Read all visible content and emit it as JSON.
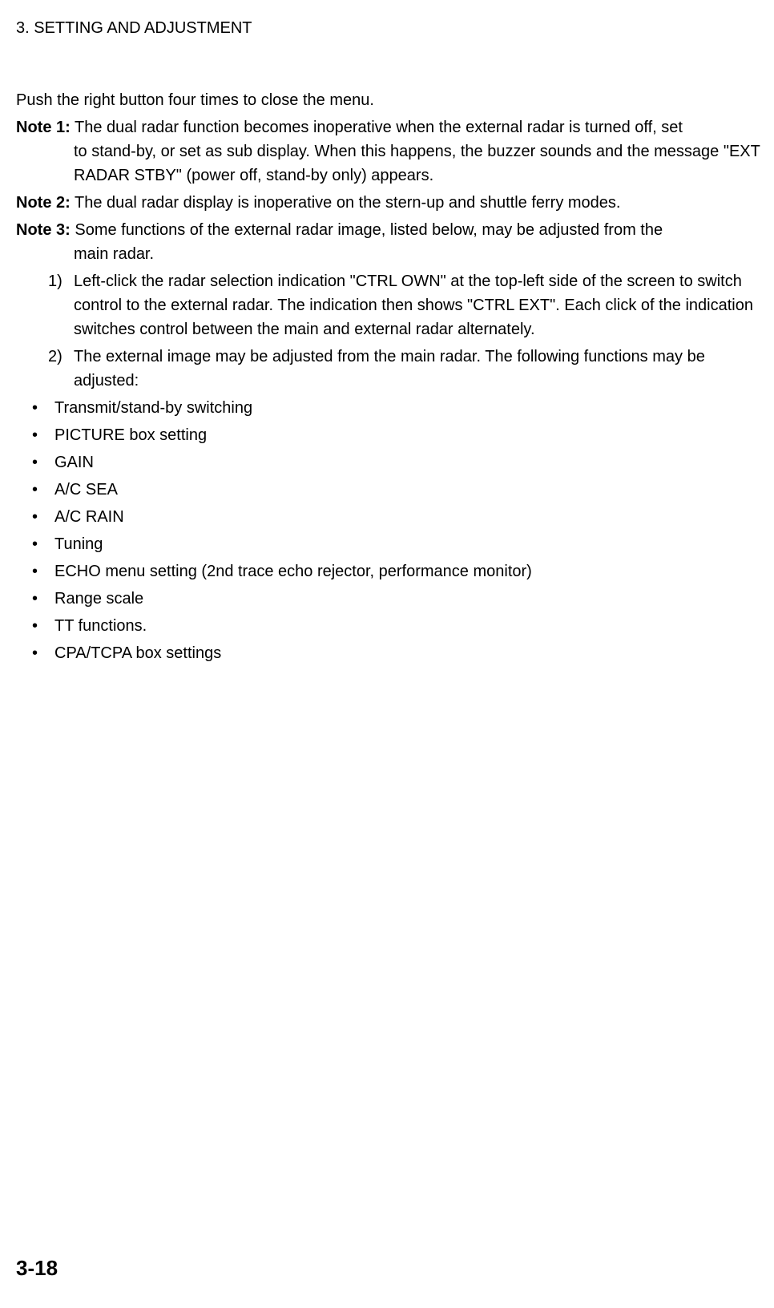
{
  "header": "3. SETTING AND ADJUSTMENT",
  "intro": "Push the right button four times to close the menu.",
  "notes": [
    {
      "label": "Note 1:",
      "text": "The dual radar function becomes inoperative when the external radar is turned off, set to stand-by, or set as sub display. When this happens, the buzzer sounds and the message \"EXT RADAR STBY\" (power off, stand-by only) appears."
    },
    {
      "label": "Note 2:",
      "text": "The dual radar display is inoperative on the stern-up and shuttle ferry modes."
    },
    {
      "label": "Note 3:",
      "text": "Some functions of the external radar image, listed below, may be adjusted from the main radar."
    }
  ],
  "numbered": [
    {
      "num": "1)",
      "text": "Left-click the radar selection indication \"CTRL OWN\" at the top-left side of the screen to switch control to the external radar. The indication then shows \"CTRL EXT\". Each click of the indication switches control between the main and external radar alternately."
    },
    {
      "num": "2)",
      "text": "The external image may be adjusted from the main radar. The following functions may be adjusted:"
    }
  ],
  "bullets": [
    "Transmit/stand-by switching",
    "PICTURE box setting",
    "GAIN",
    "A/C SEA",
    "A/C RAIN",
    "Tuning",
    "ECHO menu setting (2nd trace echo rejector, performance monitor)",
    "Range scale",
    "TT functions.",
    "CPA/TCPA box settings"
  ],
  "pageNumber": "3-18"
}
